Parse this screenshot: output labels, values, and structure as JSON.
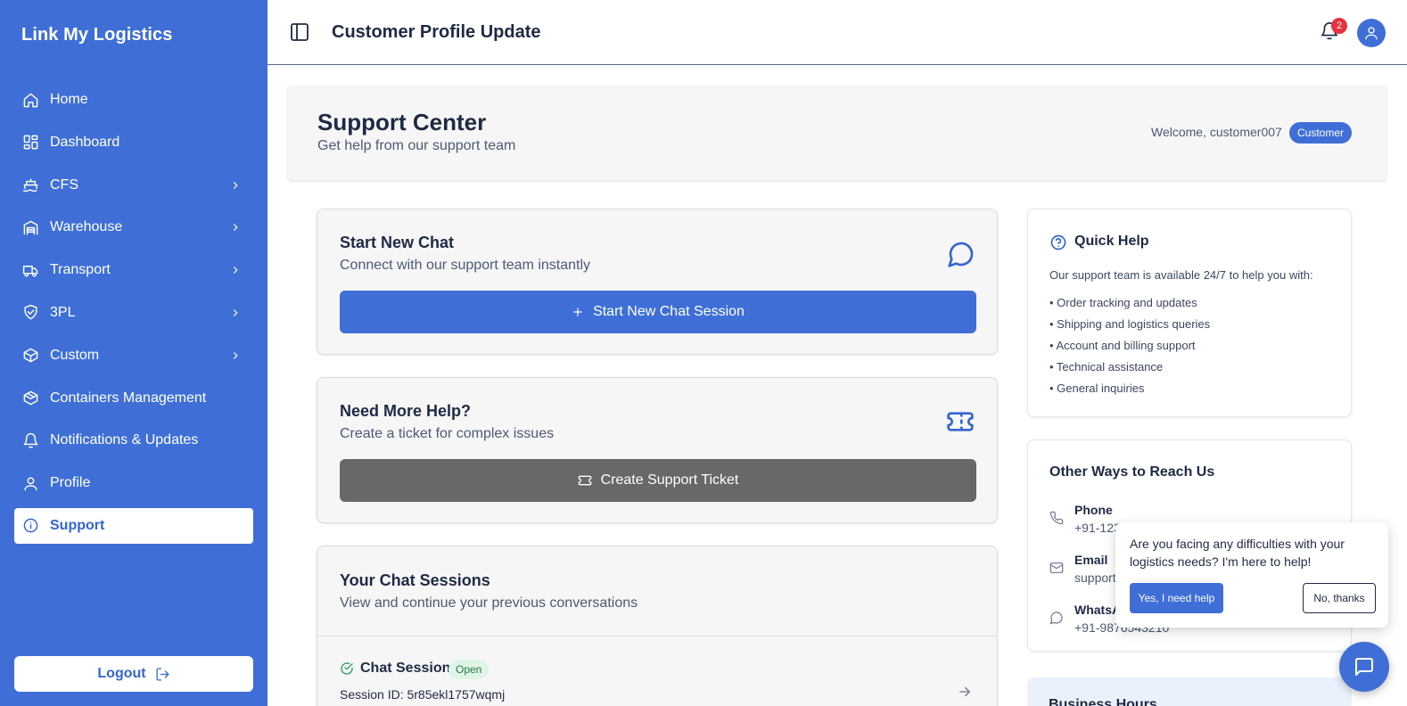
{
  "sidebar": {
    "brand": "Link My Logistics",
    "items": [
      {
        "label": "Home",
        "icon": "home-icon"
      },
      {
        "label": "Dashboard",
        "icon": "dashboard-icon"
      },
      {
        "label": "CFS",
        "icon": "ship-icon"
      },
      {
        "label": "Warehouse",
        "icon": "warehouse-icon"
      },
      {
        "label": "Transport",
        "icon": "truck-icon"
      },
      {
        "label": "3PL",
        "icon": "handshake-icon"
      },
      {
        "label": "Custom",
        "icon": "package-icon"
      },
      {
        "label": "Containers Management",
        "icon": "container-icon"
      },
      {
        "label": "Notifications & Updates",
        "icon": "bell-icon"
      },
      {
        "label": "Profile",
        "icon": "user-icon"
      },
      {
        "label": "Support",
        "icon": "info-icon"
      }
    ],
    "active": "Support",
    "logout_label": "Logout"
  },
  "header": {
    "title": "Customer Profile Update",
    "notification_count": "2"
  },
  "support": {
    "title": "Support Center",
    "subtitle": "Get help from our support team",
    "welcome": "Welcome, customer007",
    "role": "Customer"
  },
  "new_chat": {
    "title": "Start New Chat",
    "subtitle": "Connect with our support team instantly",
    "button": "Start New Chat Session"
  },
  "more_help": {
    "title": "Need More Help?",
    "subtitle": "Create a ticket for complex issues",
    "button": "Create Support Ticket"
  },
  "sessions": {
    "title": "Your Chat Sessions",
    "subtitle": "View and continue your previous conversations",
    "items": [
      {
        "name": "Chat Session",
        "status": "Open",
        "session_id": "Session ID: 5r85ekl1757wqmj"
      }
    ]
  },
  "quick_help": {
    "title": "Quick Help",
    "intro": "Our support team is available 24/7 to help you with:",
    "items": [
      "• Order tracking and updates",
      "• Shipping and logistics queries",
      "• Account and billing support",
      "• Technical assistance",
      "• General inquiries"
    ]
  },
  "other_ways": {
    "title": "Other Ways to Reach Us",
    "contacts": [
      {
        "label": "Phone",
        "value": "+91-1234567890",
        "icon": "phone-icon"
      },
      {
        "label": "Email",
        "value": "support@linkmylogistics.com",
        "icon": "mail-icon"
      },
      {
        "label": "WhatsApp",
        "value": "+91-9876543210",
        "icon": "whatsapp-icon"
      }
    ]
  },
  "next_card": {
    "title": "Business Hours"
  },
  "popup": {
    "text": "Are you facing any difficulties with your logistics needs? I'm here to help!",
    "yes": "Yes, I need help",
    "no": "No, thanks"
  },
  "colors": {
    "primary": "#3f6fd6",
    "sidebar": "#3f6fd6",
    "badge_red": "#e5323c",
    "open_green": "#2ea05a",
    "ticket_gray": "#676869"
  }
}
